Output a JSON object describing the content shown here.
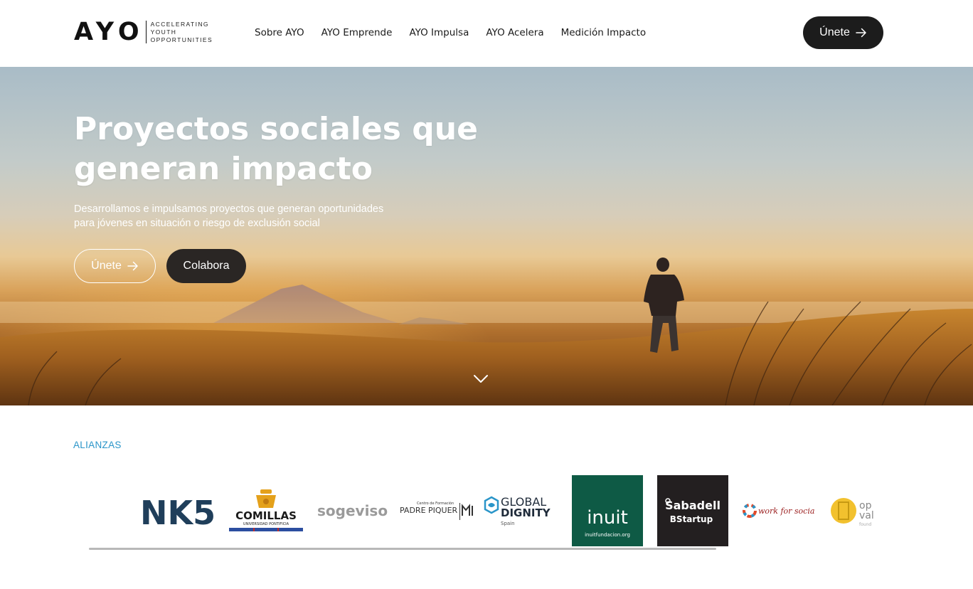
{
  "header": {
    "logo": {
      "mark": "AYO",
      "tagline": [
        "ACCELERATING",
        "YOUTH",
        "OPPORTUNITIES"
      ]
    },
    "nav": [
      {
        "label": "Sobre AYO"
      },
      {
        "label": "AYO Emprende"
      },
      {
        "label": "AYO Impulsa"
      },
      {
        "label": "AYO Acelera"
      },
      {
        "label": "Medición Impacto"
      }
    ],
    "cta_label": "Únete"
  },
  "hero": {
    "title_line1": "Proyectos sociales que",
    "title_line2": "generan impacto",
    "subtitle_line1": "Desarrollamos e impulsamos proyectos que generan oportunidades",
    "subtitle_line2": "para jóvenes en situación o riesgo de exclusión social",
    "primary_button": "Únete",
    "secondary_button": "Colabora"
  },
  "alliances": {
    "label": "ALIANZAS",
    "partners": [
      {
        "name": "NK5",
        "text": "NK5",
        "color": "#1f3e5a"
      },
      {
        "name": "Comillas",
        "text": "COMILLAS",
        "subtext": "UNIVERSIDAD PONTIFICIA",
        "color": "#1a1a1a",
        "accent": "#e4a11b"
      },
      {
        "name": "sogeviso",
        "text": "sogeviso",
        "color": "#9a9a9a"
      },
      {
        "name": "Padre Piquer",
        "text": "PADRE PIQUER",
        "pretext": "Centro de Formación",
        "color": "#333333"
      },
      {
        "name": "Global Dignity",
        "text_top": "GLOBAL",
        "text_bottom": "DIGNITY",
        "subtext": "Spain",
        "color": "#1f2b3a",
        "accent": "#2a95c9"
      },
      {
        "name": "inuit",
        "text": "inuit",
        "subtext": "inuitfundacion.org",
        "color": "#ffffff",
        "bg": "#0e5a45"
      },
      {
        "name": "Sabadell BStartup",
        "text_top": "Sabadell",
        "text_bottom": "BStartup",
        "color": "#ffffff",
        "bg": "#231f20"
      },
      {
        "name": "work for social",
        "text": "work for social",
        "color": "#9a1c1c"
      },
      {
        "name": "Opval",
        "text_top": "op",
        "text_bottom": "val",
        "subtext": "found",
        "color": "#888888",
        "accent": "#f2c12e"
      }
    ]
  },
  "colors": {
    "accent_blue": "#2a95c9",
    "dark_button": "#1c1c1c"
  }
}
